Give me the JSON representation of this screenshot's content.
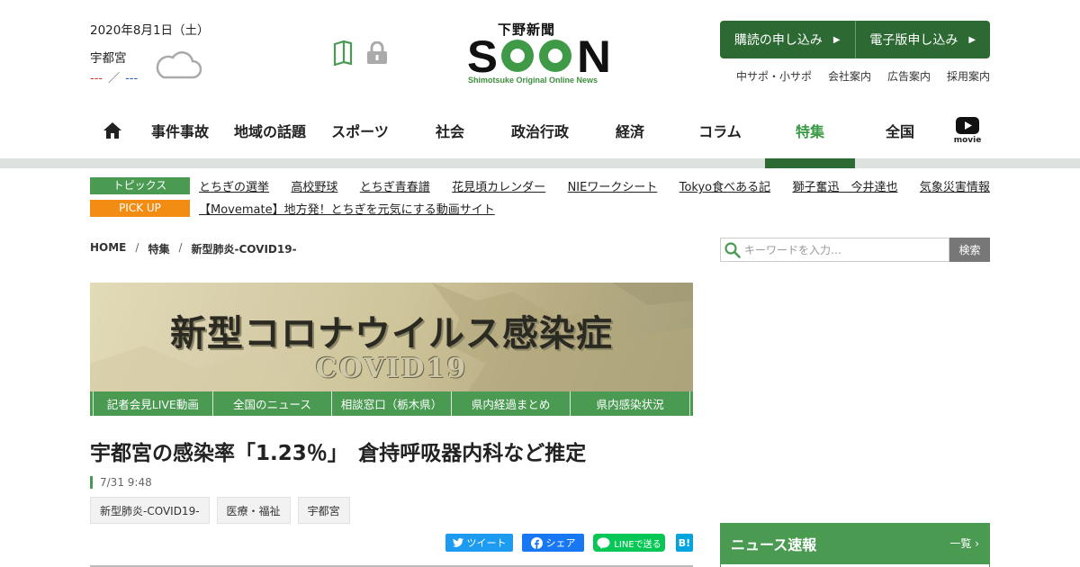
{
  "header": {
    "date": "2020年8月1日（土）",
    "weather": {
      "city": "宇都宮",
      "high": "---",
      "separator": "／",
      "low": "---",
      "icon": "cloud-icon"
    },
    "logo": {
      "kanji": "下野新聞",
      "wordmark": "SOON",
      "tagline": "Shimotsuke Original Online News"
    },
    "buttons": [
      {
        "label": "購読の申し込み",
        "arrow": "▶"
      },
      {
        "label": "電子版申し込み",
        "arrow": "▶"
      }
    ],
    "util_links": [
      "中サポ・小サポ",
      "会社案内",
      "広告案内",
      "採用案内"
    ]
  },
  "nav": {
    "items": [
      "事件事故",
      "地域の話題",
      "スポーツ",
      "社会",
      "政治行政",
      "経済",
      "コラム",
      "特集",
      "全国"
    ],
    "active": "特集",
    "movie_label": "movie"
  },
  "topics": {
    "label": "トピックス",
    "links": [
      "とちぎの選挙",
      "高校野球",
      "とちぎ青春譜",
      "花見頃カレンダー",
      "NIEワークシート",
      "Tokyo食べある記",
      "獅子奮迅　今井達也",
      "気象災害情報"
    ]
  },
  "pickup": {
    "label": "PICK UP",
    "link": "【Movemate】地方発！とちぎを元気にする動画サイト"
  },
  "breadcrumb": [
    "HOME",
    "特集",
    "新型肺炎-COVID19-"
  ],
  "search": {
    "placeholder": "キーワードを入力…",
    "button": "検索"
  },
  "banner": {
    "title": "新型コロナウイルス感染症",
    "subtitle": "COVID19",
    "tabs": [
      "記者会見LIVE動画",
      "全国のニュース",
      "相談窓口（栃木県）",
      "県内経過まとめ",
      "県内感染状況"
    ]
  },
  "article": {
    "headline": "宇都宮の感染率「1.23％」　倉持呼吸器内科など推定",
    "timestamp": "7/31 9:48",
    "tags": [
      "新型肺炎-COVID19-",
      "医療・福祉",
      "宇都宮"
    ],
    "share": {
      "twitter": "ツイート",
      "facebook": "シェア",
      "line": "LINEで送る",
      "hatena": "B!"
    }
  },
  "sidebar": {
    "news_title": "ニュース速報",
    "news_more": "一覧"
  },
  "colors": {
    "brand_green": "#4a9a52",
    "dark_green": "#2d6a33",
    "pickup_orange": "#f28c12"
  }
}
